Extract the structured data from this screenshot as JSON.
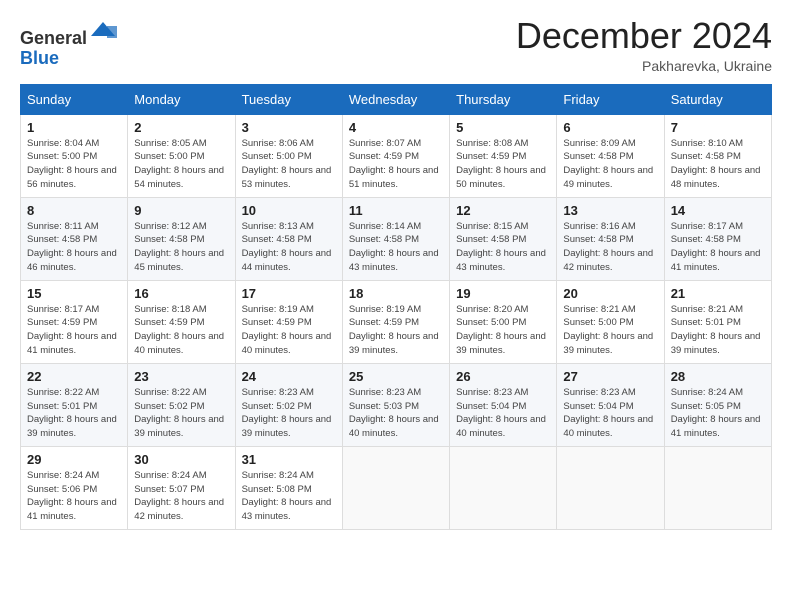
{
  "header": {
    "logo_general": "General",
    "logo_blue": "Blue",
    "month": "December 2024",
    "location": "Pakharevka, Ukraine"
  },
  "days_of_week": [
    "Sunday",
    "Monday",
    "Tuesday",
    "Wednesday",
    "Thursday",
    "Friday",
    "Saturday"
  ],
  "weeks": [
    [
      {
        "day": 1,
        "sunrise": "8:04 AM",
        "sunset": "5:00 PM",
        "daylight": "8 hours and 56 minutes."
      },
      {
        "day": 2,
        "sunrise": "8:05 AM",
        "sunset": "5:00 PM",
        "daylight": "8 hours and 54 minutes."
      },
      {
        "day": 3,
        "sunrise": "8:06 AM",
        "sunset": "5:00 PM",
        "daylight": "8 hours and 53 minutes."
      },
      {
        "day": 4,
        "sunrise": "8:07 AM",
        "sunset": "4:59 PM",
        "daylight": "8 hours and 51 minutes."
      },
      {
        "day": 5,
        "sunrise": "8:08 AM",
        "sunset": "4:59 PM",
        "daylight": "8 hours and 50 minutes."
      },
      {
        "day": 6,
        "sunrise": "8:09 AM",
        "sunset": "4:58 PM",
        "daylight": "8 hours and 49 minutes."
      },
      {
        "day": 7,
        "sunrise": "8:10 AM",
        "sunset": "4:58 PM",
        "daylight": "8 hours and 48 minutes."
      }
    ],
    [
      {
        "day": 8,
        "sunrise": "8:11 AM",
        "sunset": "4:58 PM",
        "daylight": "8 hours and 46 minutes."
      },
      {
        "day": 9,
        "sunrise": "8:12 AM",
        "sunset": "4:58 PM",
        "daylight": "8 hours and 45 minutes."
      },
      {
        "day": 10,
        "sunrise": "8:13 AM",
        "sunset": "4:58 PM",
        "daylight": "8 hours and 44 minutes."
      },
      {
        "day": 11,
        "sunrise": "8:14 AM",
        "sunset": "4:58 PM",
        "daylight": "8 hours and 43 minutes."
      },
      {
        "day": 12,
        "sunrise": "8:15 AM",
        "sunset": "4:58 PM",
        "daylight": "8 hours and 43 minutes."
      },
      {
        "day": 13,
        "sunrise": "8:16 AM",
        "sunset": "4:58 PM",
        "daylight": "8 hours and 42 minutes."
      },
      {
        "day": 14,
        "sunrise": "8:17 AM",
        "sunset": "4:58 PM",
        "daylight": "8 hours and 41 minutes."
      }
    ],
    [
      {
        "day": 15,
        "sunrise": "8:17 AM",
        "sunset": "4:59 PM",
        "daylight": "8 hours and 41 minutes."
      },
      {
        "day": 16,
        "sunrise": "8:18 AM",
        "sunset": "4:59 PM",
        "daylight": "8 hours and 40 minutes."
      },
      {
        "day": 17,
        "sunrise": "8:19 AM",
        "sunset": "4:59 PM",
        "daylight": "8 hours and 40 minutes."
      },
      {
        "day": 18,
        "sunrise": "8:19 AM",
        "sunset": "4:59 PM",
        "daylight": "8 hours and 39 minutes."
      },
      {
        "day": 19,
        "sunrise": "8:20 AM",
        "sunset": "5:00 PM",
        "daylight": "8 hours and 39 minutes."
      },
      {
        "day": 20,
        "sunrise": "8:21 AM",
        "sunset": "5:00 PM",
        "daylight": "8 hours and 39 minutes."
      },
      {
        "day": 21,
        "sunrise": "8:21 AM",
        "sunset": "5:01 PM",
        "daylight": "8 hours and 39 minutes."
      }
    ],
    [
      {
        "day": 22,
        "sunrise": "8:22 AM",
        "sunset": "5:01 PM",
        "daylight": "8 hours and 39 minutes."
      },
      {
        "day": 23,
        "sunrise": "8:22 AM",
        "sunset": "5:02 PM",
        "daylight": "8 hours and 39 minutes."
      },
      {
        "day": 24,
        "sunrise": "8:23 AM",
        "sunset": "5:02 PM",
        "daylight": "8 hours and 39 minutes."
      },
      {
        "day": 25,
        "sunrise": "8:23 AM",
        "sunset": "5:03 PM",
        "daylight": "8 hours and 40 minutes."
      },
      {
        "day": 26,
        "sunrise": "8:23 AM",
        "sunset": "5:04 PM",
        "daylight": "8 hours and 40 minutes."
      },
      {
        "day": 27,
        "sunrise": "8:23 AM",
        "sunset": "5:04 PM",
        "daylight": "8 hours and 40 minutes."
      },
      {
        "day": 28,
        "sunrise": "8:24 AM",
        "sunset": "5:05 PM",
        "daylight": "8 hours and 41 minutes."
      }
    ],
    [
      {
        "day": 29,
        "sunrise": "8:24 AM",
        "sunset": "5:06 PM",
        "daylight": "8 hours and 41 minutes."
      },
      {
        "day": 30,
        "sunrise": "8:24 AM",
        "sunset": "5:07 PM",
        "daylight": "8 hours and 42 minutes."
      },
      {
        "day": 31,
        "sunrise": "8:24 AM",
        "sunset": "5:08 PM",
        "daylight": "8 hours and 43 minutes."
      },
      null,
      null,
      null,
      null
    ]
  ]
}
